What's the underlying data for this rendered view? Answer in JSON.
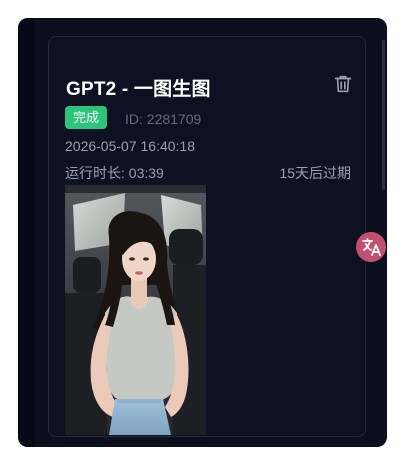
{
  "task": {
    "title": "GPT2 - 一图生图",
    "status": "完成",
    "id_text": "ID: 2281709",
    "created_at": "2026-05-07 16:40:18",
    "runtime_text": "运行时长: 03:39",
    "expire_text": "15天后过期"
  },
  "colors": {
    "background": "#0b0f1e",
    "status_success": "#2bc47a",
    "translate_button": "#c2506f"
  },
  "icons": {
    "delete": "trash-icon",
    "translate": "translate-icon"
  }
}
